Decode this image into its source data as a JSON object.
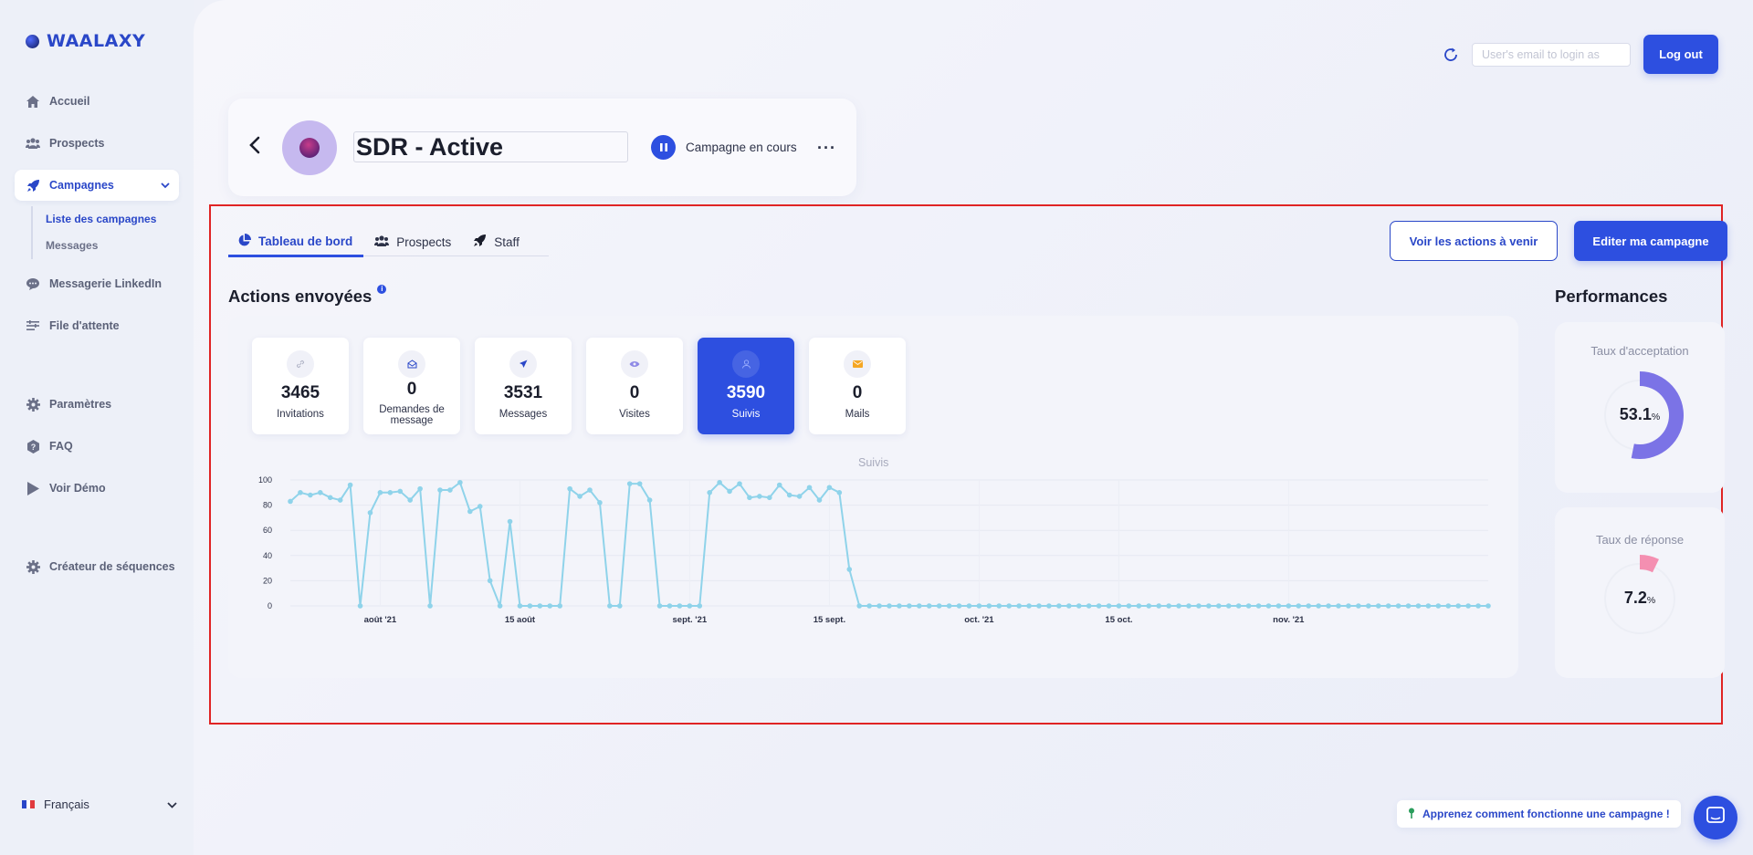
{
  "app": {
    "logo": "WAALAXY"
  },
  "sidebar": {
    "items": [
      {
        "label": "Accueil",
        "icon": "home-icon"
      },
      {
        "label": "Prospects",
        "icon": "users-icon"
      },
      {
        "label": "Campagnes",
        "icon": "rocket-icon",
        "active": true
      },
      {
        "label": "Messagerie LinkedIn",
        "icon": "chat-icon"
      },
      {
        "label": "File d'attente",
        "icon": "queue-icon"
      },
      {
        "label": "Paramètres",
        "icon": "gear-icon"
      },
      {
        "label": "FAQ",
        "icon": "help-icon"
      },
      {
        "label": "Voir Démo",
        "icon": "play-icon"
      },
      {
        "label": "Créateur de séquences",
        "icon": "gear-icon"
      }
    ],
    "sub_items": [
      {
        "label": "Liste des campagnes"
      },
      {
        "label": "Messages"
      }
    ],
    "language": "Français"
  },
  "topbar": {
    "login_placeholder": "User's email to login as",
    "logout_label": "Log out"
  },
  "campaign": {
    "name": "SDR - Active",
    "status": "Campagne en cours",
    "more": "···"
  },
  "tabs": [
    {
      "label": "Tableau de bord",
      "active": true
    },
    {
      "label": "Prospects"
    },
    {
      "label": "Staff"
    }
  ],
  "buttons": {
    "upcoming": "Voir les actions à venir",
    "edit": "Editer ma campagne"
  },
  "actions": {
    "title": "Actions envoyées",
    "info": "i",
    "stats": [
      {
        "value": "3465",
        "label": "Invitations"
      },
      {
        "value": "0",
        "label": "Demandes de message"
      },
      {
        "value": "3531",
        "label": "Messages"
      },
      {
        "value": "0",
        "label": "Visites"
      },
      {
        "value": "3590",
        "label": "Suivis",
        "selected": true
      },
      {
        "value": "0",
        "label": "Mails"
      }
    ]
  },
  "performances": {
    "title": "Performances",
    "acceptance": {
      "label": "Taux d'acceptation",
      "value": "53.1",
      "unit": "%",
      "fraction": 0.531,
      "color": "#7b73e6"
    },
    "response": {
      "label": "Taux de réponse",
      "value": "7.2",
      "unit": "%",
      "fraction": 0.072,
      "color": "#f48fb1"
    }
  },
  "chart_data": {
    "type": "line",
    "title": "Suivis",
    "ylim": [
      0,
      100
    ],
    "yticks": [
      0,
      20,
      40,
      60,
      80,
      100
    ],
    "xticks": [
      {
        "label": "août '21",
        "index": 9
      },
      {
        "label": "15 août",
        "index": 23
      },
      {
        "label": "sept. '21",
        "index": 40
      },
      {
        "label": "15 sept.",
        "index": 54
      },
      {
        "label": "oct. '21",
        "index": 69
      },
      {
        "label": "15 oct.",
        "index": 83
      },
      {
        "label": "nov. '21",
        "index": 100
      }
    ],
    "color": "#8fd3ea",
    "values": [
      83,
      90,
      88,
      90,
      86,
      84,
      96,
      0,
      74,
      90,
      90,
      91,
      84,
      93,
      0,
      92,
      92,
      98,
      75,
      79,
      20,
      0,
      67,
      0,
      0,
      0,
      0,
      0,
      93,
      87,
      92,
      82,
      0,
      0,
      97,
      97,
      84,
      0,
      0,
      0,
      0,
      0,
      90,
      98,
      91,
      97,
      86,
      87,
      86,
      96,
      88,
      87,
      94,
      84,
      94,
      90,
      29,
      0,
      0,
      0,
      0,
      0,
      0,
      0,
      0,
      0,
      0,
      0,
      0,
      0,
      0,
      0,
      0,
      0,
      0,
      0,
      0,
      0,
      0,
      0,
      0,
      0,
      0,
      0,
      0,
      0,
      0,
      0,
      0,
      0,
      0,
      0,
      0,
      0,
      0,
      0,
      0,
      0,
      0,
      0,
      0,
      0,
      0,
      0,
      0,
      0,
      0,
      0,
      0,
      0,
      0,
      0,
      0,
      0,
      0,
      0,
      0,
      0,
      0,
      0,
      0
    ]
  }
}
